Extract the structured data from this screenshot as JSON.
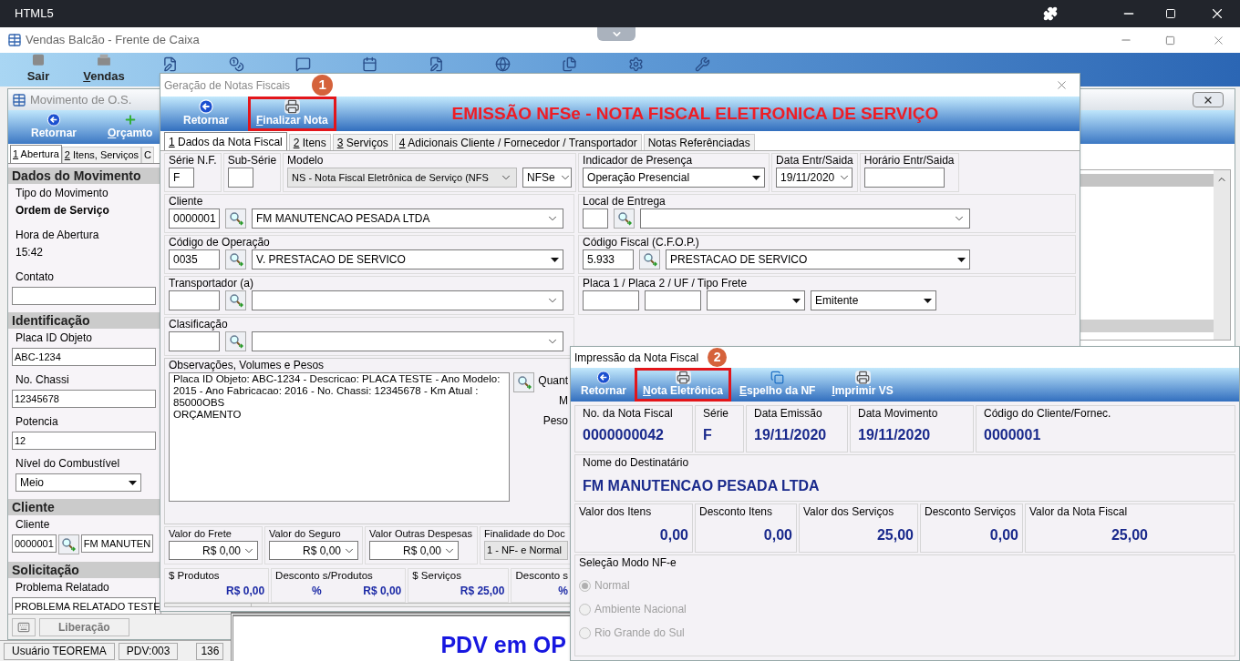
{
  "host_bar": {
    "title": "HTML5"
  },
  "app_window": {
    "title": "Vendas Balcão - Frente de Caixa",
    "toolbar": [
      {
        "label": "Sair",
        "kind": "exit",
        "underline_first": false
      },
      {
        "label": "Vendas",
        "kind": "sales",
        "underline_first": true
      }
    ],
    "status_bar": [
      "Usuário TEOREMA",
      "PDV:003",
      "136"
    ]
  },
  "os_window": {
    "title": "Movimento de O.S.",
    "toolbar": [
      {
        "label": "Retornar",
        "kind": "back",
        "underline_first": false
      },
      {
        "label": "Orçamto",
        "kind": "add",
        "underline_first": true
      }
    ],
    "tabs": [
      {
        "label": "1 Abertura",
        "selected": true,
        "underline_first": true
      },
      {
        "label": "2 Itens, Serviços",
        "selected": false,
        "underline_first": true
      },
      {
        "label": "C",
        "selected": false,
        "underline_first": false
      }
    ],
    "sections": [
      {
        "title": "Dados do Movimento",
        "fields": [
          {
            "kind": "label",
            "text": "Tipo do Movimento"
          },
          {
            "kind": "strong",
            "text": "Ordem de Serviço"
          },
          {
            "kind": "label",
            "text": "Hora de Abertura"
          },
          {
            "kind": "plain",
            "text": "15:42"
          },
          {
            "kind": "label",
            "text": "Contato"
          },
          {
            "kind": "input"
          }
        ]
      },
      {
        "title": "Identificação",
        "fields": [
          {
            "kind": "label",
            "text": "Placa ID Objeto"
          },
          {
            "kind": "input",
            "text": "ABC-1234"
          },
          {
            "kind": "label",
            "text": "No. Chassi"
          },
          {
            "kind": "input",
            "text": "12345678"
          },
          {
            "kind": "label",
            "text": "Potencia"
          },
          {
            "kind": "input",
            "text": "12"
          },
          {
            "kind": "label",
            "text": "Nível do Combustível"
          },
          {
            "kind": "select",
            "text": "Meio"
          }
        ]
      },
      {
        "title": "Cliente",
        "fields": [
          {
            "kind": "label",
            "text": "Cliente"
          },
          {
            "kind": "lookup",
            "code": "0000001",
            "text": "FM MANUTEN"
          }
        ]
      },
      {
        "title": "Solicitação",
        "fields": [
          {
            "kind": "label",
            "text": "Problema Relatado"
          },
          {
            "kind": "input",
            "text": "PROBLEMA RELATADO TESTE"
          }
        ]
      }
    ],
    "bottom_tabs": [
      "Liberação"
    ]
  },
  "pdv_panel": {
    "text": "PDV em OP"
  },
  "nf_window": {
    "title": "Geração de Notas Fiscais",
    "badge": "1",
    "toolbar": [
      {
        "label": "Retornar",
        "kind": "back",
        "underline_first": false,
        "highlighted": false
      },
      {
        "label": "Finalizar Nota",
        "kind": "print",
        "underline_first": true,
        "highlighted": true
      }
    ],
    "banner": "EMISSÃO NFSe - NOTA FISCAL ELETRONICA DE SERVIÇO",
    "tabs": [
      {
        "label": "1 Dados da Nota Fiscal",
        "selected": true,
        "underline_first": true
      },
      {
        "label": "2 Itens",
        "selected": false,
        "underline_first": true
      },
      {
        "label": "3 Serviços",
        "selected": false,
        "underline_first": true
      },
      {
        "label": "4 Adicionais Cliente / Fornecedor / Transportador",
        "selected": false,
        "underline_first": true
      },
      {
        "label": "Notas Referênciadas",
        "selected": false,
        "underline_first": false
      }
    ],
    "header_row": [
      {
        "label": "Série N.F.",
        "controls": [
          {
            "kind": "box",
            "value": "F"
          }
        ]
      },
      {
        "label": "Sub-Série",
        "controls": [
          {
            "kind": "box"
          }
        ]
      },
      {
        "label": "Modelo",
        "controls": [
          {
            "kind": "locked",
            "value": "NS - Nota Fiscal Eletrônica de Serviço (NFS"
          },
          {
            "kind": "mini",
            "value": "NFSe"
          }
        ]
      },
      {
        "label": "Indicador de Presença",
        "controls": [
          {
            "kind": "dropdown",
            "value": "Operação Presencial"
          }
        ]
      },
      {
        "label": "Data Entr/Saida",
        "controls": [
          {
            "kind": "picker",
            "value": "19/11/2020"
          }
        ]
      },
      {
        "label": "Horário Entr/Saida",
        "controls": [
          {
            "kind": "field"
          }
        ]
      }
    ],
    "pair_rows": [
      [
        {
          "label": "Cliente",
          "controls": [
            {
              "kind": "code",
              "value": "0000001"
            },
            {
              "kind": "lookup"
            },
            {
              "kind": "combo",
              "value": "FM MANUTENCAO PESADA LTDA"
            }
          ]
        },
        {
          "label": "Local de Entrega",
          "controls": [
            {
              "kind": "box"
            },
            {
              "kind": "lookup"
            },
            {
              "kind": "combo"
            }
          ]
        }
      ],
      [
        {
          "label": "Código de Operação",
          "controls": [
            {
              "kind": "code",
              "value": "0035"
            },
            {
              "kind": "lookup"
            },
            {
              "kind": "dropdown",
              "value": "V. PRESTACAO DE SERVICO"
            }
          ]
        },
        {
          "label": "Código Fiscal (C.F.O.P.)",
          "controls": [
            {
              "kind": "code",
              "value": "5.933"
            },
            {
              "kind": "lookup"
            },
            {
              "kind": "dropdown",
              "value": "PRESTACAO DE SERVICO"
            }
          ]
        }
      ],
      [
        {
          "label": "Transportador (a)",
          "controls": [
            {
              "kind": "code"
            },
            {
              "kind": "lookup"
            },
            {
              "kind": "combo"
            }
          ]
        },
        {
          "label": "Placa 1 / Placa 2 / UF / Tipo Frete",
          "controls": [
            {
              "kind": "plate"
            },
            {
              "kind": "plate"
            },
            {
              "kind": "choice"
            },
            {
              "kind": "selector",
              "value": "Emitente"
            }
          ]
        }
      ],
      [
        {
          "label": "Clasificação",
          "controls": [
            {
              "kind": "code"
            },
            {
              "kind": "lookup"
            },
            {
              "kind": "combo"
            }
          ]
        }
      ]
    ],
    "observations": {
      "label": "Observações, Volumes e Pesos",
      "text": "Placa ID Objeto: ABC-1234 - Descricao: PLACA TESTE - Ano Modelo: 2015 - Ano Fabricacao: 2016 - No. Chassi: 12345678 - Km Atual : 85000OBS\nORÇAMENTO",
      "side_labels": [
        "Quant",
        "M",
        "Peso"
      ]
    },
    "charges": [
      {
        "label": "Valor do Frete",
        "kind": "money",
        "value": "R$ 0,00"
      },
      {
        "label": "Valor do Seguro",
        "kind": "money",
        "value": "R$ 0,00"
      },
      {
        "label": "Valor Outras Despesas",
        "kind": "money",
        "value": "R$ 0,00"
      },
      {
        "label": "Finalidade do Doc",
        "kind": "locked",
        "value": "1 - NF- e Normal"
      }
    ],
    "totals": [
      {
        "label": "$ Produtos",
        "values": [
          "R$ 0,00"
        ]
      },
      {
        "label": "Desconto s/Produtos",
        "values": [
          "%",
          "R$ 0,00"
        ]
      },
      {
        "label": "$ Serviços",
        "values": [
          "R$ 25,00"
        ]
      },
      {
        "label": "Desconto s",
        "values": [
          "%"
        ]
      }
    ]
  },
  "print_window": {
    "title": "Impressão da Nota Fiscal",
    "badge": "2",
    "toolbar": [
      {
        "label": "Retornar",
        "kind": "back",
        "underline_first": false,
        "highlighted": false
      },
      {
        "label": "Nota Eletrônica",
        "kind": "print",
        "underline_first": true,
        "highlighted": true
      },
      {
        "label": "Espelho da NF",
        "kind": "mirror",
        "underline_first": true,
        "highlighted": false
      },
      {
        "label": "Imprimir VS",
        "kind": "print",
        "underline_first": true,
        "highlighted": false
      }
    ],
    "summary": [
      {
        "label": "No. da Nota Fiscal",
        "value": "0000000042"
      },
      {
        "label": "Série",
        "value": "F"
      },
      {
        "label": "Data Emissão",
        "value": "19/11/2020"
      },
      {
        "label": "Data Movimento",
        "value": "19/11/2020"
      },
      {
        "label": "Código do Cliente/Fornec.",
        "value": "0000001"
      }
    ],
    "recipient": {
      "label": "Nome do Destinatário",
      "value": "FM MANUTENCAO PESADA LTDA"
    },
    "amounts": [
      {
        "label": "Valor dos Itens",
        "value": "0,00"
      },
      {
        "label": "Desconto Itens",
        "value": "0,00"
      },
      {
        "label": "Valor dos Serviços",
        "value": "25,00"
      },
      {
        "label": "Desconto Serviços",
        "value": "0,00"
      },
      {
        "label": "Valor da Nota Fiscal",
        "value": "25,00"
      }
    ],
    "mode": {
      "label": "Seleção Modo NF-e",
      "disabled": true,
      "options": [
        {
          "label": "Normal",
          "selected": true
        },
        {
          "label": "Ambiente Nacional",
          "selected": false
        },
        {
          "label": "Rio Grande do Sul",
          "selected": false
        }
      ]
    }
  }
}
